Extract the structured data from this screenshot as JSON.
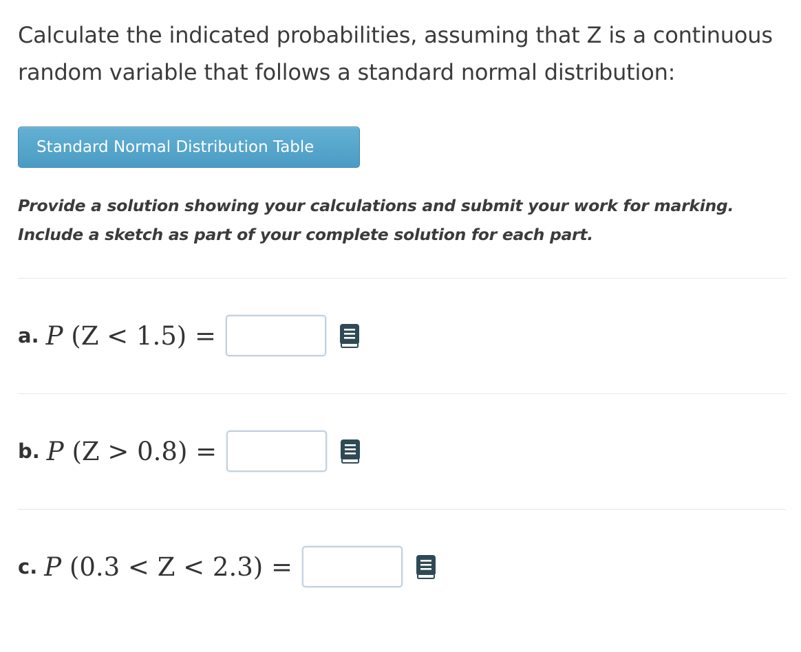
{
  "question": {
    "intro": "Calculate the indicated probabilities, assuming that Z is a continuous random variable that follows a standard normal distribution:",
    "table_button_label": "Standard Normal Distribution Table",
    "instructions_line1": "Provide a solution showing your calculations and submit your work for marking.",
    "instructions_line2": "Include a sketch as part of your complete solution for each part."
  },
  "parts": [
    {
      "letter": "a.",
      "prefix": "P",
      "expression": " (Z < 1.5) =",
      "answer": "",
      "icon": "notebook-icon"
    },
    {
      "letter": "b.",
      "prefix": "P",
      "expression": " (Z > 0.8) =",
      "answer": "",
      "icon": "notebook-icon"
    },
    {
      "letter": "c.",
      "prefix": "P",
      "expression": " (0.3 < Z < 2.3) =",
      "answer": "",
      "icon": "notebook-icon"
    }
  ],
  "colors": {
    "button": "#54a4ca",
    "text": "#3b3b3b",
    "input_border": "#c3d1de",
    "icon": "#2f4a55"
  }
}
